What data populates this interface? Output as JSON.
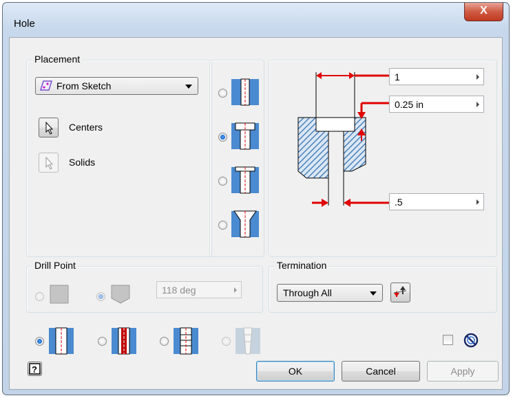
{
  "window": {
    "title": "Hole",
    "close_label": "X"
  },
  "placement": {
    "label": "Placement",
    "mode": "From Sketch",
    "centers_label": "Centers",
    "solids_label": "Solids"
  },
  "hole_types": {
    "selected": 1,
    "options": [
      "simple-hole",
      "counterbore",
      "spotface",
      "countersink"
    ]
  },
  "dimensions": {
    "diameter_top": "1",
    "depth": "0.25 in",
    "diameter_bottom": ".5"
  },
  "drill_point": {
    "label": "Drill Point",
    "angle": "118 deg",
    "selected": "angled"
  },
  "termination": {
    "label": "Termination",
    "value": "Through All"
  },
  "thread_types": {
    "selected": 0,
    "options": [
      "simple",
      "clearance",
      "tapped",
      "taper-tapped"
    ]
  },
  "buttons": {
    "ok": "OK",
    "cancel": "Cancel",
    "apply": "Apply"
  },
  "colors": {
    "accent": "#e00000",
    "hatch": "#2f6fb2"
  }
}
